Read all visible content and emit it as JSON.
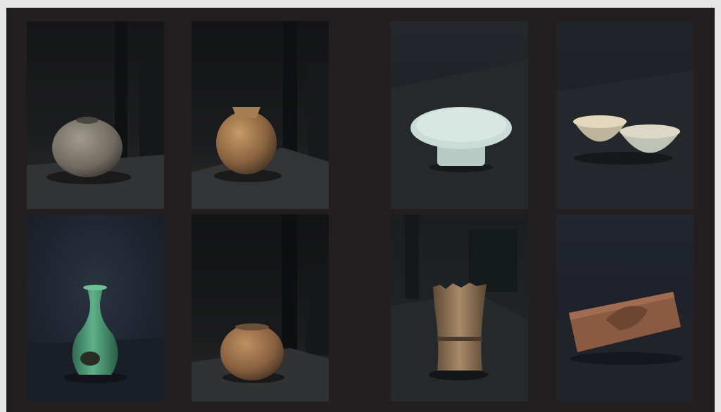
{
  "gallery": {
    "photos": [
      {
        "subject": "weathered-round-stoneware-jar",
        "background": "dark-industrial",
        "object_color": "#8a8276"
      },
      {
        "subject": "earthenware-jar-with-flared-rim",
        "background": "dark-industrial",
        "object_color": "#a87a4e"
      },
      {
        "subject": "celadon-footed-plate",
        "background": "dark-studio",
        "object_color": "#c9ddd6"
      },
      {
        "subject": "pair-of-pale-bowls",
        "background": "dark-studio",
        "object_color": "#cfc6ad"
      },
      {
        "subject": "green-celadon-bottle-vase",
        "background": "dark-blue-studio",
        "object_color": "#4f9a78"
      },
      {
        "subject": "small-earthenware-jar",
        "background": "dark-industrial",
        "object_color": "#a0704a"
      },
      {
        "subject": "weathered-wooden-cylinder-vessel",
        "background": "dark-industrial",
        "object_color": "#9a7f60"
      },
      {
        "subject": "carved-clay-brick",
        "background": "dark-studio",
        "object_color": "#8a5a42"
      }
    ]
  }
}
